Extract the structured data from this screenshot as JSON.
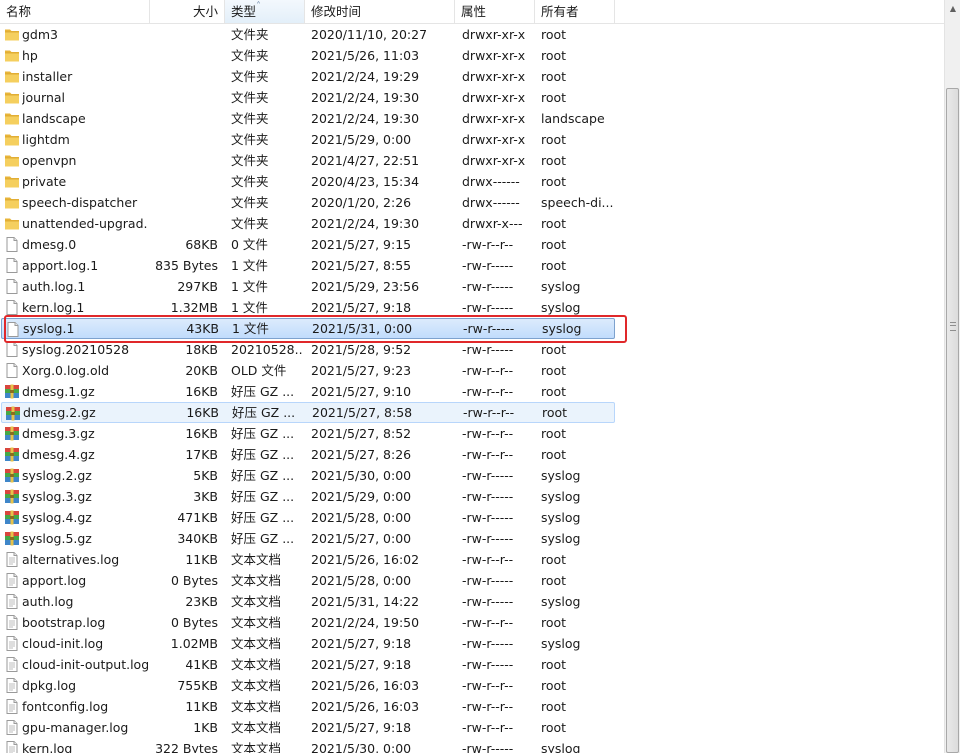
{
  "columns": {
    "name": "名称",
    "size": "大小",
    "type": "类型",
    "modified": "修改时间",
    "attributes": "属性",
    "owner": "所有者"
  },
  "sort": {
    "column": "type",
    "arrow": "˄"
  },
  "scroll": {
    "up_arrow": "▲"
  },
  "files": [
    {
      "icon": "folder-icon",
      "name": "gdm3",
      "size": "",
      "type": "文件夹",
      "modified": "2020/11/10, 20:27",
      "attributes": "drwxr-xr-x",
      "owner": "root"
    },
    {
      "icon": "folder-icon",
      "name": "hp",
      "size": "",
      "type": "文件夹",
      "modified": "2021/5/26, 11:03",
      "attributes": "drwxr-xr-x",
      "owner": "root"
    },
    {
      "icon": "folder-icon",
      "name": "installer",
      "size": "",
      "type": "文件夹",
      "modified": "2021/2/24, 19:29",
      "attributes": "drwxr-xr-x",
      "owner": "root"
    },
    {
      "icon": "folder-icon",
      "name": "journal",
      "size": "",
      "type": "文件夹",
      "modified": "2021/2/24, 19:30",
      "attributes": "drwxr-xr-x",
      "owner": "root"
    },
    {
      "icon": "folder-icon",
      "name": "landscape",
      "size": "",
      "type": "文件夹",
      "modified": "2021/2/24, 19:30",
      "attributes": "drwxr-xr-x",
      "owner": "landscape"
    },
    {
      "icon": "folder-icon",
      "name": "lightdm",
      "size": "",
      "type": "文件夹",
      "modified": "2021/5/29, 0:00",
      "attributes": "drwxr-xr-x",
      "owner": "root"
    },
    {
      "icon": "folder-icon",
      "name": "openvpn",
      "size": "",
      "type": "文件夹",
      "modified": "2021/4/27, 22:51",
      "attributes": "drwxr-xr-x",
      "owner": "root"
    },
    {
      "icon": "folder-icon",
      "name": "private",
      "size": "",
      "type": "文件夹",
      "modified": "2020/4/23, 15:34",
      "attributes": "drwx------",
      "owner": "root"
    },
    {
      "icon": "folder-icon",
      "name": "speech-dispatcher",
      "size": "",
      "type": "文件夹",
      "modified": "2020/1/20, 2:26",
      "attributes": "drwx------",
      "owner": "speech-di..."
    },
    {
      "icon": "folder-icon",
      "name": "unattended-upgrad...",
      "size": "",
      "type": "文件夹",
      "modified": "2021/2/24, 19:30",
      "attributes": "drwxr-x---",
      "owner": "root"
    },
    {
      "icon": "file-icon",
      "name": "dmesg.0",
      "size": "68KB",
      "type": "0 文件",
      "modified": "2021/5/27, 9:15",
      "attributes": "-rw-r--r--",
      "owner": "root"
    },
    {
      "icon": "file-icon",
      "name": "apport.log.1",
      "size": "835 Bytes",
      "type": "1 文件",
      "modified": "2021/5/27, 8:55",
      "attributes": "-rw-r-----",
      "owner": "root"
    },
    {
      "icon": "file-icon",
      "name": "auth.log.1",
      "size": "297KB",
      "type": "1 文件",
      "modified": "2021/5/29, 23:56",
      "attributes": "-rw-r-----",
      "owner": "syslog"
    },
    {
      "icon": "file-icon",
      "name": "kern.log.1",
      "size": "1.32MB",
      "type": "1 文件",
      "modified": "2021/5/27, 9:18",
      "attributes": "-rw-r-----",
      "owner": "syslog"
    },
    {
      "icon": "file-icon",
      "name": "syslog.1",
      "size": "43KB",
      "type": "1 文件",
      "modified": "2021/5/31, 0:00",
      "attributes": "-rw-r-----",
      "owner": "syslog",
      "state": "selected"
    },
    {
      "icon": "file-icon",
      "name": "syslog.20210528",
      "size": "18KB",
      "type": "20210528...",
      "modified": "2021/5/28, 9:52",
      "attributes": "-rw-r-----",
      "owner": "root"
    },
    {
      "icon": "file-icon",
      "name": "Xorg.0.log.old",
      "size": "20KB",
      "type": "OLD 文件",
      "modified": "2021/5/27, 9:23",
      "attributes": "-rw-r--r--",
      "owner": "root"
    },
    {
      "icon": "archive-icon",
      "name": "dmesg.1.gz",
      "size": "16KB",
      "type": "好压 GZ ...",
      "modified": "2021/5/27, 9:10",
      "attributes": "-rw-r--r--",
      "owner": "root"
    },
    {
      "icon": "archive-icon",
      "name": "dmesg.2.gz",
      "size": "16KB",
      "type": "好压 GZ ...",
      "modified": "2021/5/27, 8:58",
      "attributes": "-rw-r--r--",
      "owner": "root",
      "state": "hover"
    },
    {
      "icon": "archive-icon",
      "name": "dmesg.3.gz",
      "size": "16KB",
      "type": "好压 GZ ...",
      "modified": "2021/5/27, 8:52",
      "attributes": "-rw-r--r--",
      "owner": "root"
    },
    {
      "icon": "archive-icon",
      "name": "dmesg.4.gz",
      "size": "17KB",
      "type": "好压 GZ ...",
      "modified": "2021/5/27, 8:26",
      "attributes": "-rw-r--r--",
      "owner": "root"
    },
    {
      "icon": "archive-icon",
      "name": "syslog.2.gz",
      "size": "5KB",
      "type": "好压 GZ ...",
      "modified": "2021/5/30, 0:00",
      "attributes": "-rw-r-----",
      "owner": "syslog"
    },
    {
      "icon": "archive-icon",
      "name": "syslog.3.gz",
      "size": "3KB",
      "type": "好压 GZ ...",
      "modified": "2021/5/29, 0:00",
      "attributes": "-rw-r-----",
      "owner": "syslog"
    },
    {
      "icon": "archive-icon",
      "name": "syslog.4.gz",
      "size": "471KB",
      "type": "好压 GZ ...",
      "modified": "2021/5/28, 0:00",
      "attributes": "-rw-r-----",
      "owner": "syslog"
    },
    {
      "icon": "archive-icon",
      "name": "syslog.5.gz",
      "size": "340KB",
      "type": "好压 GZ ...",
      "modified": "2021/5/27, 0:00",
      "attributes": "-rw-r-----",
      "owner": "syslog"
    },
    {
      "icon": "text-file-icon",
      "name": "alternatives.log",
      "size": "11KB",
      "type": "文本文档",
      "modified": "2021/5/26, 16:02",
      "attributes": "-rw-r--r--",
      "owner": "root"
    },
    {
      "icon": "text-file-icon",
      "name": "apport.log",
      "size": "0 Bytes",
      "type": "文本文档",
      "modified": "2021/5/28, 0:00",
      "attributes": "-rw-r-----",
      "owner": "root"
    },
    {
      "icon": "text-file-icon",
      "name": "auth.log",
      "size": "23KB",
      "type": "文本文档",
      "modified": "2021/5/31, 14:22",
      "attributes": "-rw-r-----",
      "owner": "syslog"
    },
    {
      "icon": "text-file-icon",
      "name": "bootstrap.log",
      "size": "0 Bytes",
      "type": "文本文档",
      "modified": "2021/2/24, 19:50",
      "attributes": "-rw-r--r--",
      "owner": "root"
    },
    {
      "icon": "text-file-icon",
      "name": "cloud-init.log",
      "size": "1.02MB",
      "type": "文本文档",
      "modified": "2021/5/27, 9:18",
      "attributes": "-rw-r-----",
      "owner": "syslog"
    },
    {
      "icon": "text-file-icon",
      "name": "cloud-init-output.log",
      "size": "41KB",
      "type": "文本文档",
      "modified": "2021/5/27, 9:18",
      "attributes": "-rw-r-----",
      "owner": "root"
    },
    {
      "icon": "text-file-icon",
      "name": "dpkg.log",
      "size": "755KB",
      "type": "文本文档",
      "modified": "2021/5/26, 16:03",
      "attributes": "-rw-r--r--",
      "owner": "root"
    },
    {
      "icon": "text-file-icon",
      "name": "fontconfig.log",
      "size": "11KB",
      "type": "文本文档",
      "modified": "2021/5/26, 16:03",
      "attributes": "-rw-r--r--",
      "owner": "root"
    },
    {
      "icon": "text-file-icon",
      "name": "gpu-manager.log",
      "size": "1KB",
      "type": "文本文档",
      "modified": "2021/5/27, 9:18",
      "attributes": "-rw-r--r--",
      "owner": "root"
    },
    {
      "icon": "text-file-icon",
      "name": "kern.log",
      "size": "322 Bytes",
      "type": "文本文档",
      "modified": "2021/5/30, 0:00",
      "attributes": "-rw-r-----",
      "owner": "syslog"
    }
  ]
}
